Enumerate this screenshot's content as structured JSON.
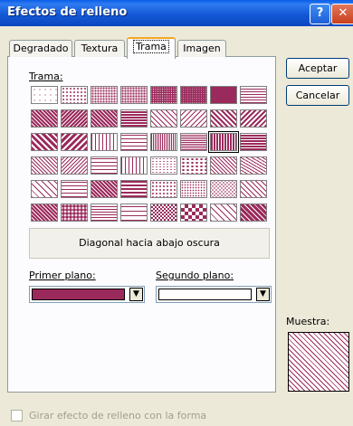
{
  "window": {
    "title": "Efectos de relleno"
  },
  "titlebar": {
    "help_glyph": "?",
    "close_glyph": "✕"
  },
  "tabs": [
    {
      "label": "Degradado",
      "active": false
    },
    {
      "label": "Textura",
      "active": false
    },
    {
      "label": "Trama",
      "active": true
    },
    {
      "label": "Imagen",
      "active": false
    }
  ],
  "trama": {
    "label": "Trama:",
    "selected_name": "Diagonal hacia abajo oscura",
    "selected_index": 22,
    "fg_color": "#9b2a5c",
    "bg_color": "#ffffff"
  },
  "pattern_names": [
    "dots5",
    "dots10",
    "dots20",
    "dots25",
    "dots30",
    "dots40",
    "dots50",
    "dots60",
    "dots70",
    "dots75",
    "dots80",
    "dots90",
    "ltdnDiag",
    "ltupDiag",
    "dkdnDiag",
    "dkupDiag",
    "wdnDiag",
    "wupDiag",
    "ltVert",
    "ltHorz",
    "narVert",
    "narHorz",
    "dkVert",
    "dkHorz",
    "dashdnDiag",
    "dashupDiag",
    "dashHorz",
    "dashVert",
    "smConfetti",
    "lgConfetti",
    "zigZag",
    "wave",
    "diagBrick",
    "horzBrick",
    "weave",
    "plaid",
    "divot",
    "dotGrid",
    "dotDmnd",
    "shingle",
    "trellis",
    "sphere",
    "smGrid",
    "lgGrid",
    "smCheck",
    "lgCheck",
    "openDmnd",
    "solidDmnd"
  ],
  "foreground": {
    "label": "Primer plano:",
    "color": "#9b2a5c"
  },
  "background": {
    "label": "Segundo plano:",
    "color": "#ffffff"
  },
  "buttons": {
    "accept": "Aceptar",
    "cancel": "Cancelar"
  },
  "sample": {
    "label": "Muestra:"
  },
  "rotate_checkbox": {
    "label": "Girar efecto de relleno con la forma",
    "checked": false,
    "enabled": false
  }
}
